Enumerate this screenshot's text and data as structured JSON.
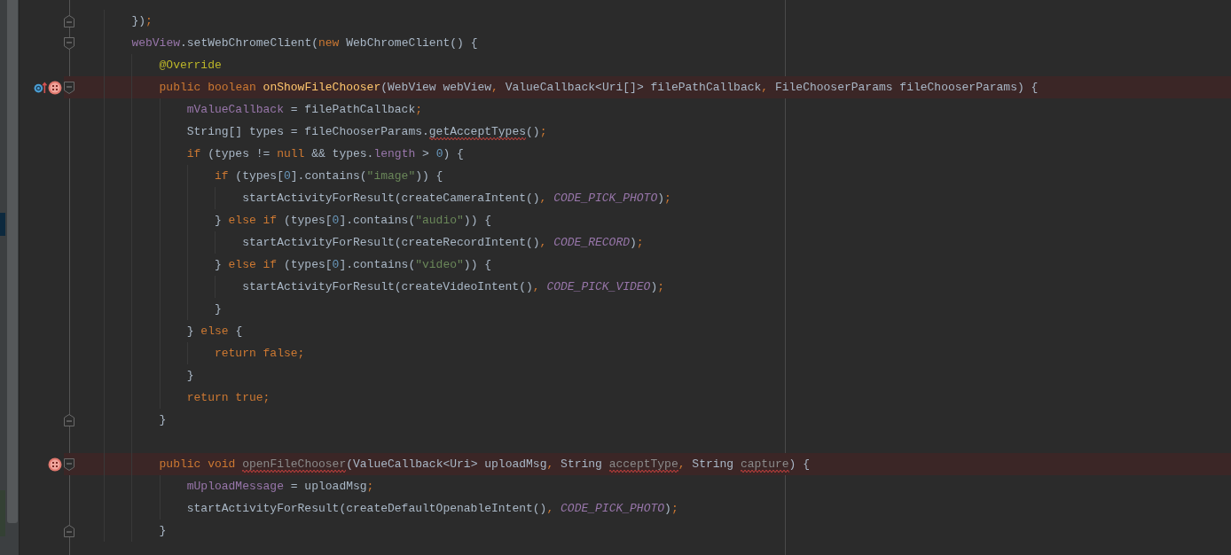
{
  "editor": {
    "lines": [
      {
        "fold_start": false,
        "fold_end": true,
        "breakpoint": false,
        "override_marker": false,
        "tokens": [
          {
            "text": "})",
            "kind": "plain",
            "warning": false
          },
          {
            "text": ";",
            "kind": "keyword",
            "warning": false
          }
        ]
      },
      {
        "fold_start": true,
        "fold_end": false,
        "breakpoint": false,
        "override_marker": false,
        "tokens": [
          {
            "text": "webView",
            "kind": "field",
            "warning": false
          },
          {
            "text": ".setWebChromeClient(",
            "kind": "plain",
            "warning": false
          },
          {
            "text": "new",
            "kind": "keyword",
            "warning": false
          },
          {
            "text": " WebChromeClient() {",
            "kind": "plain",
            "warning": false
          }
        ],
        "children": [
          {
            "fold_start": false,
            "fold_end": false,
            "breakpoint": false,
            "override_marker": false,
            "tokens": [
              {
                "text": "@Override",
                "kind": "annotation",
                "warning": false
              }
            ]
          },
          {
            "fold_start": true,
            "fold_end": false,
            "breakpoint": true,
            "override_marker": true,
            "tokens": [
              {
                "text": "public boolean ",
                "kind": "keyword",
                "warning": false
              },
              {
                "text": "onShowFileChooser",
                "kind": "method",
                "warning": false
              },
              {
                "text": "(WebView webView",
                "kind": "plain",
                "warning": false
              },
              {
                "text": ",",
                "kind": "keyword",
                "warning": false
              },
              {
                "text": " ValueCallback<Uri[]> filePathCallback",
                "kind": "plain",
                "warning": false
              },
              {
                "text": ",",
                "kind": "keyword",
                "warning": false
              },
              {
                "text": " FileChooserParams fileChooserParams) {",
                "kind": "plain",
                "warning": false
              }
            ],
            "children": [
              {
                "fold_start": false,
                "fold_end": false,
                "breakpoint": false,
                "override_marker": false,
                "tokens": [
                  {
                    "text": "mValueCallback",
                    "kind": "field",
                    "warning": false
                  },
                  {
                    "text": " = filePathCallback",
                    "kind": "plain",
                    "warning": false
                  },
                  {
                    "text": ";",
                    "kind": "keyword",
                    "warning": false
                  }
                ]
              },
              {
                "fold_start": false,
                "fold_end": false,
                "breakpoint": false,
                "override_marker": false,
                "tokens": [
                  {
                    "text": "String[] types = fileChooserParams.",
                    "kind": "plain",
                    "warning": false
                  },
                  {
                    "text": "getAcceptTypes",
                    "kind": "plain",
                    "warning": true
                  },
                  {
                    "text": "()",
                    "kind": "plain",
                    "warning": false
                  },
                  {
                    "text": ";",
                    "kind": "keyword",
                    "warning": false
                  }
                ]
              },
              {
                "fold_start": false,
                "fold_end": false,
                "breakpoint": false,
                "override_marker": false,
                "tokens": [
                  {
                    "text": "if",
                    "kind": "keyword",
                    "warning": false
                  },
                  {
                    "text": " (types != ",
                    "kind": "plain",
                    "warning": false
                  },
                  {
                    "text": "null",
                    "kind": "keyword",
                    "warning": false
                  },
                  {
                    "text": " && types.",
                    "kind": "plain",
                    "warning": false
                  },
                  {
                    "text": "length",
                    "kind": "field",
                    "warning": false
                  },
                  {
                    "text": " > ",
                    "kind": "plain",
                    "warning": false
                  },
                  {
                    "text": "0",
                    "kind": "number",
                    "warning": false
                  },
                  {
                    "text": ") {",
                    "kind": "plain",
                    "warning": false
                  }
                ],
                "children": [
                  {
                    "fold_start": false,
                    "fold_end": false,
                    "breakpoint": false,
                    "override_marker": false,
                    "tokens": [
                      {
                        "text": "if",
                        "kind": "keyword",
                        "warning": false
                      },
                      {
                        "text": " (types[",
                        "kind": "plain",
                        "warning": false
                      },
                      {
                        "text": "0",
                        "kind": "number",
                        "warning": false
                      },
                      {
                        "text": "].contains(",
                        "kind": "plain",
                        "warning": false
                      },
                      {
                        "text": "\"image\"",
                        "kind": "string",
                        "warning": false
                      },
                      {
                        "text": ")) {",
                        "kind": "plain",
                        "warning": false
                      }
                    ],
                    "children": [
                      {
                        "fold_start": false,
                        "fold_end": false,
                        "breakpoint": false,
                        "override_marker": false,
                        "tokens": [
                          {
                            "text": "startActivityForResult(createCameraIntent()",
                            "kind": "plain",
                            "warning": false
                          },
                          {
                            "text": ", ",
                            "kind": "keyword",
                            "warning": false
                          },
                          {
                            "text": "CODE_PICK_PHOTO",
                            "kind": "constant",
                            "warning": false
                          },
                          {
                            "text": ")",
                            "kind": "plain",
                            "warning": false
                          },
                          {
                            "text": ";",
                            "kind": "keyword",
                            "warning": false
                          }
                        ]
                      }
                    ]
                  },
                  {
                    "fold_start": false,
                    "fold_end": false,
                    "breakpoint": false,
                    "override_marker": false,
                    "tokens": [
                      {
                        "text": "} ",
                        "kind": "plain",
                        "warning": false
                      },
                      {
                        "text": "else if",
                        "kind": "keyword",
                        "warning": false
                      },
                      {
                        "text": " (types[",
                        "kind": "plain",
                        "warning": false
                      },
                      {
                        "text": "0",
                        "kind": "number",
                        "warning": false
                      },
                      {
                        "text": "].contains(",
                        "kind": "plain",
                        "warning": false
                      },
                      {
                        "text": "\"audio\"",
                        "kind": "string",
                        "warning": false
                      },
                      {
                        "text": ")) {",
                        "kind": "plain",
                        "warning": false
                      }
                    ],
                    "children": [
                      {
                        "fold_start": false,
                        "fold_end": false,
                        "breakpoint": false,
                        "override_marker": false,
                        "tokens": [
                          {
                            "text": "startActivityForResult(createRecordIntent()",
                            "kind": "plain",
                            "warning": false
                          },
                          {
                            "text": ", ",
                            "kind": "keyword",
                            "warning": false
                          },
                          {
                            "text": "CODE_RECORD",
                            "kind": "constant",
                            "warning": false
                          },
                          {
                            "text": ")",
                            "kind": "plain",
                            "warning": false
                          },
                          {
                            "text": ";",
                            "kind": "keyword",
                            "warning": false
                          }
                        ]
                      }
                    ]
                  },
                  {
                    "fold_start": false,
                    "fold_end": false,
                    "breakpoint": false,
                    "override_marker": false,
                    "tokens": [
                      {
                        "text": "} ",
                        "kind": "plain",
                        "warning": false
                      },
                      {
                        "text": "else if",
                        "kind": "keyword",
                        "warning": false
                      },
                      {
                        "text": " (types[",
                        "kind": "plain",
                        "warning": false
                      },
                      {
                        "text": "0",
                        "kind": "number",
                        "warning": false
                      },
                      {
                        "text": "].contains(",
                        "kind": "plain",
                        "warning": false
                      },
                      {
                        "text": "\"video\"",
                        "kind": "string",
                        "warning": false
                      },
                      {
                        "text": ")) {",
                        "kind": "plain",
                        "warning": false
                      }
                    ],
                    "children": [
                      {
                        "fold_start": false,
                        "fold_end": false,
                        "breakpoint": false,
                        "override_marker": false,
                        "tokens": [
                          {
                            "text": "startActivityForResult(createVideoIntent()",
                            "kind": "plain",
                            "warning": false
                          },
                          {
                            "text": ", ",
                            "kind": "keyword",
                            "warning": false
                          },
                          {
                            "text": "CODE_PICK_VIDEO",
                            "kind": "constant",
                            "warning": false
                          },
                          {
                            "text": ")",
                            "kind": "plain",
                            "warning": false
                          },
                          {
                            "text": ";",
                            "kind": "keyword",
                            "warning": false
                          }
                        ]
                      }
                    ]
                  },
                  {
                    "fold_start": false,
                    "fold_end": false,
                    "breakpoint": false,
                    "override_marker": false,
                    "tokens": [
                      {
                        "text": "}",
                        "kind": "plain",
                        "warning": false
                      }
                    ]
                  }
                ]
              },
              {
                "fold_start": false,
                "fold_end": false,
                "breakpoint": false,
                "override_marker": false,
                "tokens": [
                  {
                    "text": "} ",
                    "kind": "plain",
                    "warning": false
                  },
                  {
                    "text": "else",
                    "kind": "keyword",
                    "warning": false
                  },
                  {
                    "text": " {",
                    "kind": "plain",
                    "warning": false
                  }
                ],
                "children": [
                  {
                    "fold_start": false,
                    "fold_end": false,
                    "breakpoint": false,
                    "override_marker": false,
                    "tokens": [
                      {
                        "text": "return false;",
                        "kind": "keyword",
                        "warning": false
                      }
                    ]
                  }
                ]
              },
              {
                "fold_start": false,
                "fold_end": false,
                "breakpoint": false,
                "override_marker": false,
                "tokens": [
                  {
                    "text": "}",
                    "kind": "plain",
                    "warning": false
                  }
                ]
              },
              {
                "fold_start": false,
                "fold_end": false,
                "breakpoint": false,
                "override_marker": false,
                "tokens": [
                  {
                    "text": "return true;",
                    "kind": "keyword",
                    "warning": false
                  }
                ]
              }
            ]
          },
          {
            "fold_start": false,
            "fold_end": true,
            "breakpoint": false,
            "override_marker": false,
            "tokens": [
              {
                "text": "}",
                "kind": "plain",
                "warning": false
              }
            ]
          },
          {
            "fold_start": false,
            "fold_end": false,
            "breakpoint": false,
            "override_marker": false
          },
          {
            "fold_start": true,
            "fold_end": false,
            "breakpoint": true,
            "override_marker": false,
            "tokens": [
              {
                "text": "public void ",
                "kind": "keyword",
                "warning": false
              },
              {
                "text": "openFileChooser",
                "kind": "unused",
                "warning": true
              },
              {
                "text": "(ValueCallback<Uri> uploadMsg",
                "kind": "plain",
                "warning": false
              },
              {
                "text": ",",
                "kind": "keyword",
                "warning": false
              },
              {
                "text": " String ",
                "kind": "plain",
                "warning": false
              },
              {
                "text": "acceptType",
                "kind": "unused",
                "warning": true
              },
              {
                "text": ",",
                "kind": "keyword",
                "warning": false
              },
              {
                "text": " String ",
                "kind": "plain",
                "warning": false
              },
              {
                "text": "capture",
                "kind": "unused",
                "warning": true
              },
              {
                "text": ") {",
                "kind": "plain",
                "warning": false
              }
            ],
            "children": [
              {
                "fold_start": false,
                "fold_end": false,
                "breakpoint": false,
                "override_marker": false,
                "tokens": [
                  {
                    "text": "mUploadMessage",
                    "kind": "field",
                    "warning": false
                  },
                  {
                    "text": " = uploadMsg",
                    "kind": "plain",
                    "warning": false
                  },
                  {
                    "text": ";",
                    "kind": "keyword",
                    "warning": false
                  }
                ]
              },
              {
                "fold_start": false,
                "fold_end": false,
                "breakpoint": false,
                "override_marker": false,
                "tokens": [
                  {
                    "text": "startActivityForResult(createDefaultOpenableIntent()",
                    "kind": "plain",
                    "warning": false
                  },
                  {
                    "text": ", ",
                    "kind": "keyword",
                    "warning": false
                  },
                  {
                    "text": "CODE_PICK_PHOTO",
                    "kind": "constant",
                    "warning": false
                  },
                  {
                    "text": ")",
                    "kind": "plain",
                    "warning": false
                  },
                  {
                    "text": ";",
                    "kind": "keyword",
                    "warning": false
                  }
                ]
              }
            ]
          },
          {
            "fold_start": false,
            "fold_end": true,
            "breakpoint": false,
            "override_marker": false,
            "tokens": [
              {
                "text": "}",
                "kind": "plain",
                "warning": false
              }
            ]
          }
        ]
      }
    ]
  }
}
